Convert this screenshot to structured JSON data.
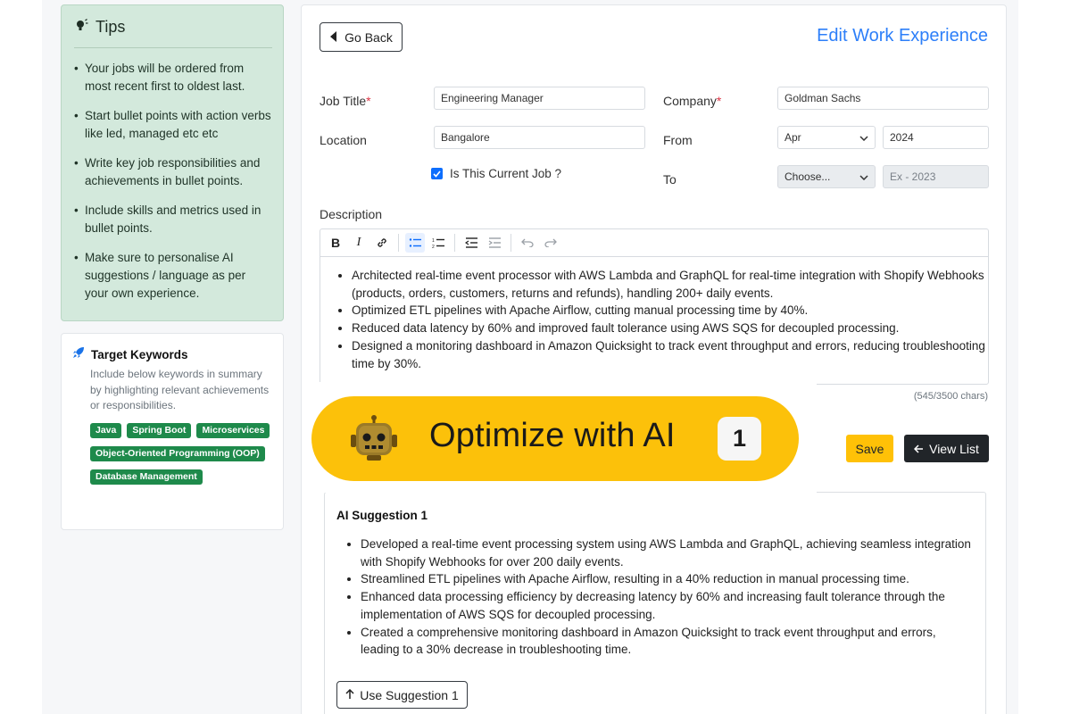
{
  "tips": {
    "title": "Tips",
    "items": [
      "Your jobs will be ordered from most recent first to oldest last.",
      "Start bullet points with action verbs like led, managed etc etc",
      "Write key job responsibilities and achievements in bullet points.",
      "Include skills and metrics used in bullet points.",
      "Make sure to personalise AI suggestions / language as per your own experience."
    ]
  },
  "keywords": {
    "title": "Target Keywords",
    "description": "Include below keywords in summary by highlighting relevant achievements or responsibilities.",
    "tags": [
      "Java",
      "Spring Boot",
      "Microservices",
      "Object-Oriented Programming (OOP)",
      "Database Management"
    ]
  },
  "header": {
    "back_label": "Go Back",
    "title": "Edit Work Experience"
  },
  "form": {
    "job_title_label": "Job Title",
    "job_title_value": "Engineering Manager",
    "company_label": "Company",
    "company_value": "Goldman Sachs",
    "location_label": "Location",
    "location_value": "Bangalore",
    "from_label": "From",
    "from_month": "Apr",
    "from_year": "2024",
    "current_job_label": "Is This Current Job ?",
    "to_label": "To",
    "to_month": "Choose...",
    "to_year_placeholder": "Ex - 2023",
    "required_mark": "*"
  },
  "description": {
    "label": "Description",
    "bullets": [
      "Architected real-time event processor with AWS Lambda and GraphQL for real-time integration with Shopify Webhooks (products, orders, customers, returns and refunds), handling 200+ daily events.",
      "Optimized ETL pipelines with Apache Airflow, cutting manual processing time by 40%.",
      "Reduced data latency by 60% and improved fault tolerance using AWS SQS for decoupled processing.",
      "Designed a monitoring dashboard in Amazon Quicksight to track event throughput and errors, reducing troubleshooting time by 30%."
    ],
    "char_count": "(545/3500 chars)"
  },
  "actions": {
    "save_label": "Save",
    "view_list_label": "View List"
  },
  "ai": {
    "optimize_label": "Optimize with AI",
    "count": "1"
  },
  "suggestion": {
    "title": "AI Suggestion 1",
    "bullets": [
      "Developed a real-time event processing system using AWS Lambda and GraphQL, achieving seamless integration with Shopify Webhooks for over 200 daily events.",
      "Streamlined ETL pipelines with Apache Airflow, resulting in a 40% reduction in manual processing time.",
      "Enhanced data processing efficiency by decreasing latency by 60% and increasing fault tolerance through the implementation of AWS SQS for decoupled processing.",
      "Created a comprehensive monitoring dashboard in Amazon Quicksight to track event throughput and errors, leading to a 30% decrease in troubleshooting time."
    ],
    "use_label": "Use Suggestion 1"
  },
  "colors": {
    "accent": "#2d7ff9",
    "tips_bg": "#d3e9dc",
    "tag_bg": "#1e8a4b",
    "save_bg": "#ffc107",
    "ai_pill_bg": "#fcc10a"
  }
}
